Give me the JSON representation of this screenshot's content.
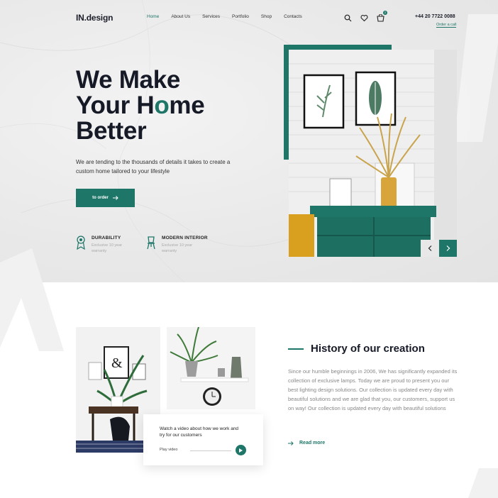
{
  "header": {
    "logo": "IN.design",
    "nav": [
      "Home",
      "About Us",
      "Services",
      "Portfolio",
      "Shop",
      "Contacts"
    ],
    "active_nav": "Home",
    "icons": [
      "search-icon",
      "heart-icon",
      "cart-icon"
    ],
    "cart_count": "2",
    "phone": "+44 20 7722 0088",
    "order_call": "Order a call"
  },
  "hero": {
    "title_part1": "We Make\nYour H",
    "title_o": "o",
    "title_part2": "me\nBetter",
    "subtitle": "We are tending to the thousands of details it takes to create a custom home tailored to your lifestyle",
    "cta": "to order",
    "features": [
      {
        "icon": "medal-icon",
        "title": "DURABILITY",
        "desc": "Exclusive 10 year warranty"
      },
      {
        "icon": "chair-icon",
        "title": "MODERN INTERIOR",
        "desc": "Exclusive 10 year warranty"
      }
    ]
  },
  "about": {
    "title": "History of our creation",
    "text": "Since our humble beginnings in 2006, We has significantly expanded its collection of exclusive lamps. Today we are proud to present you our best lighting design solutions. Our collection is updated every day with beautiful solutions and we are glad that you, our customers, support us on way! Our collection is updated every day with beautiful solutions",
    "read_more": "Read more",
    "video_title": "Watch a video about how we work and try for our customers",
    "play_label": "Play video"
  },
  "colors": {
    "accent": "#1e7668",
    "dark": "#161a26",
    "muted": "#888888"
  }
}
